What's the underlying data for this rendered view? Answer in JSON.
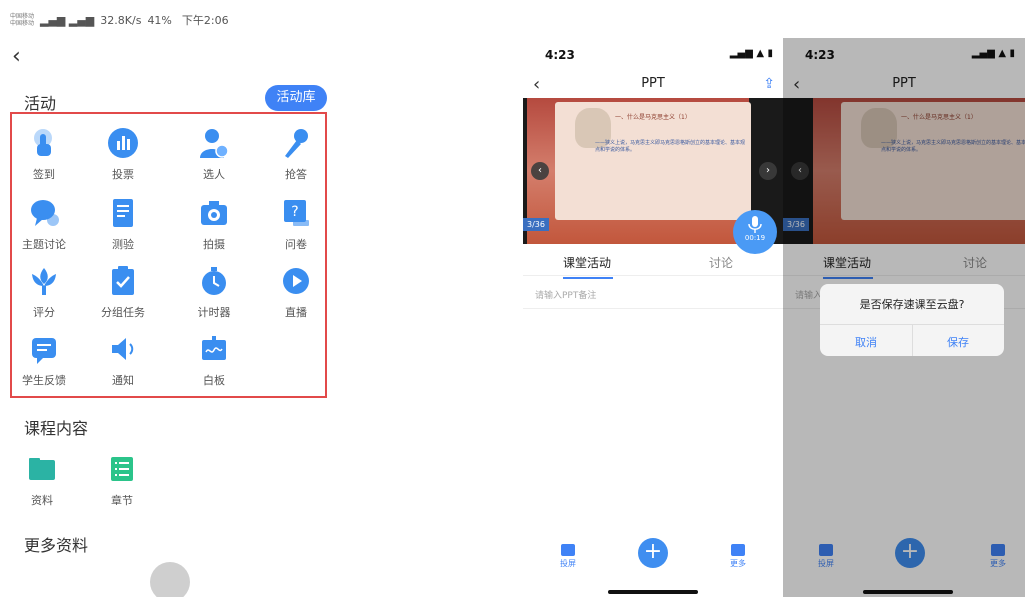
{
  "left": {
    "status": {
      "carrier1": "中国移动",
      "carrier2": "中国移动",
      "signal": "▂▄▆ ▂▄▆",
      "speed": "32.8K/s",
      "info": "41%",
      "time": "下午2:06"
    },
    "back": "‹",
    "activity_title": "活动",
    "library_button": "活动库",
    "activities": [
      {
        "label": "签到",
        "icon": "tap-icon"
      },
      {
        "label": "投票",
        "icon": "bar-chart-icon"
      },
      {
        "label": "选人",
        "icon": "person-check-icon"
      },
      {
        "label": "抢答",
        "icon": "microphone-icon"
      },
      {
        "label": "主题讨论",
        "icon": "chat-bubble-icon"
      },
      {
        "label": "测验",
        "icon": "quiz-icon"
      },
      {
        "label": "拍摄",
        "icon": "camera-icon"
      },
      {
        "label": "问卷",
        "icon": "question-form-icon"
      },
      {
        "label": "评分",
        "icon": "flower-icon"
      },
      {
        "label": "分组任务",
        "icon": "clipboard-check-icon"
      },
      {
        "label": "计时器",
        "icon": "timer-icon"
      },
      {
        "label": "直播",
        "icon": "play-icon"
      },
      {
        "label": "学生反馈",
        "icon": "feedback-icon"
      },
      {
        "label": "通知",
        "icon": "speaker-icon"
      },
      {
        "label": "白板",
        "icon": "whiteboard-icon"
      }
    ],
    "course_title": "课程内容",
    "course_items": [
      {
        "label": "资料",
        "icon": "folder-icon"
      },
      {
        "label": "章节",
        "icon": "list-icon"
      }
    ],
    "more_title": "更多资料"
  },
  "mid": {
    "status": {
      "time": "4:23",
      "icons": "▂▄▆ ▲ ▮"
    },
    "back": "‹",
    "title": "PPT",
    "share": "⇪",
    "slide": {
      "title": "一、什么是马克思主义（1）",
      "body": "——狭义上说，马克思主义即马克思恩格斯创立的基本理论、基本观点和学说的体系。",
      "page": "3/36"
    },
    "prev": "‹",
    "next": "›",
    "mic": {
      "icon": "0",
      "time": "00:19"
    },
    "tab_active": "课堂活动",
    "tab_other": "讨论",
    "note_placeholder": "请输入PPT备注",
    "bottom": {
      "cast": "投屏",
      "plus": "+",
      "more": "更多"
    }
  },
  "right": {
    "status": {
      "time": "4:23",
      "icons": "▂▄▆ ▲ ▮"
    },
    "back": "‹",
    "title": "PPT",
    "slide_page": "3/36",
    "tab_active": "课堂活动",
    "tab_other": "讨论",
    "note_placeholder": "请输入",
    "dialog": {
      "question": "是否保存速课至云盘?",
      "cancel": "取消",
      "save": "保存"
    },
    "bottom": {
      "cast": "投屏",
      "plus": "+",
      "more": "更多"
    }
  },
  "colors": {
    "accent": "#3f82f6",
    "highlight_border": "#e24a4a",
    "icon_blue": "#3a8ef0"
  }
}
